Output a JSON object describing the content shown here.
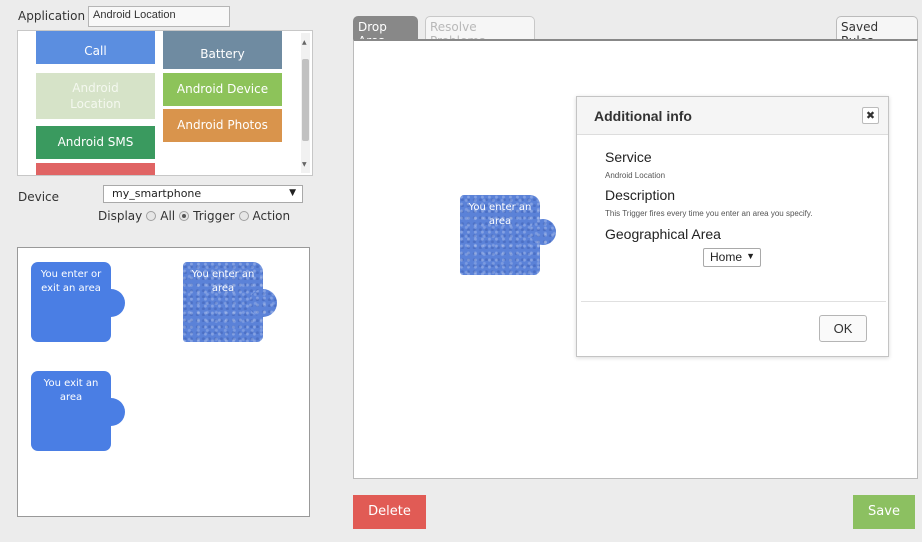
{
  "application": {
    "label": "Application",
    "value": "Android Location"
  },
  "services": [
    {
      "name": "Android Phone Call",
      "label": "Call",
      "color": "#5b8ee0"
    },
    {
      "name": "Android Battery",
      "label": "Battery",
      "color": "#6f8ba1"
    },
    {
      "name": "Android Location",
      "label": "Android Location",
      "color": "#d6e3c8"
    },
    {
      "name": "Android Device",
      "label": "Android Device",
      "color": "#8dc35a"
    },
    {
      "name": "Android SMS",
      "label": "Android SMS",
      "color": "#3a9a5f"
    },
    {
      "name": "Android Photos",
      "label": "Android Photos",
      "color": "#d9944c"
    },
    {
      "name": "",
      "label": "",
      "color": "#e06464"
    }
  ],
  "device": {
    "label": "Device",
    "selected": "my_smartphone"
  },
  "display_filter": {
    "label": "Display",
    "options": [
      "All",
      "Trigger",
      "Action"
    ],
    "selected": "Trigger"
  },
  "palette_pieces": [
    {
      "label": "You enter or exit an area"
    },
    {
      "label": "You enter an area"
    },
    {
      "label": "You exit an area"
    }
  ],
  "tabs": {
    "drop_area": "Drop Area",
    "resolve_problems": "Resolve Problems",
    "saved_rules": "Saved Rules"
  },
  "drop_piece": {
    "label": "You enter an area"
  },
  "modal": {
    "title": "Additional info",
    "close_symbol": "✖",
    "service_heading": "Service",
    "service_value": "Android Location",
    "description_heading": "Description",
    "description_value": "This Trigger fires every time you enter an area you specify.",
    "area_heading": "Geographical Area",
    "area_selected": "Home",
    "ok_label": "OK"
  },
  "buttons": {
    "delete": "Delete",
    "save": "Save"
  },
  "colors": {
    "piece_blue": "#4a7ee4",
    "delete_red": "#e15b55",
    "save_green": "#8cc061"
  }
}
